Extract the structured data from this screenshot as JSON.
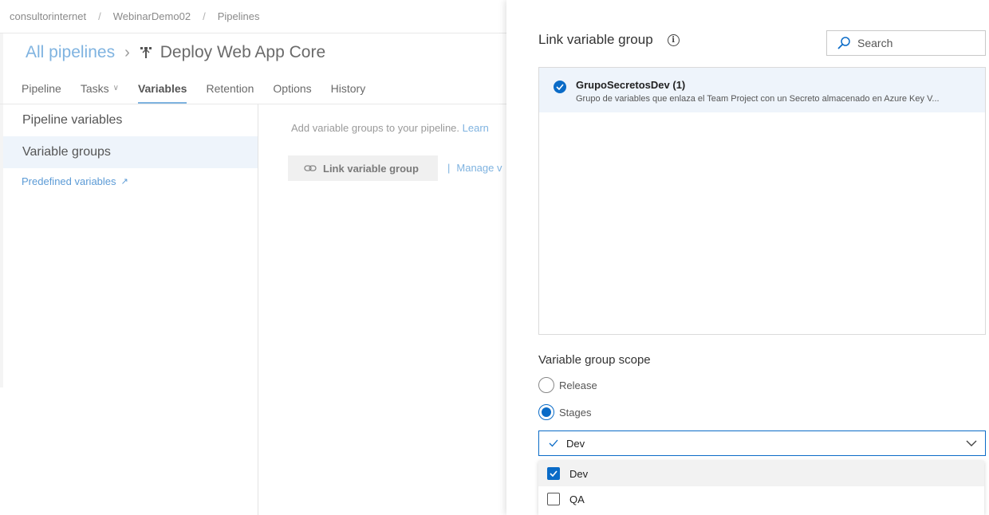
{
  "breadcrumb": {
    "org": "consultorinternet",
    "project": "WebinarDemo02",
    "section": "Pipelines"
  },
  "header": {
    "all_pipelines": "All pipelines",
    "pipeline_name": "Deploy Web App Core"
  },
  "tabs": [
    {
      "label": "Pipeline"
    },
    {
      "label": "Tasks"
    },
    {
      "label": "Variables"
    },
    {
      "label": "Retention"
    },
    {
      "label": "Options"
    },
    {
      "label": "History"
    }
  ],
  "sidebar": {
    "items": [
      {
        "label": "Pipeline variables"
      },
      {
        "label": "Variable groups"
      }
    ],
    "predefined_link": "Predefined variables"
  },
  "main": {
    "hint": "Add variable groups to your pipeline.",
    "learn": "Learn",
    "link_button": "Link variable group",
    "manage_link": "Manage v"
  },
  "panel": {
    "title": "Link variable group",
    "search_placeholder": "Search",
    "groups": [
      {
        "name": "GrupoSecretosDev (1)",
        "description": "Grupo de variables que enlaza el Team Project con un Secreto almacenado en Azure Key V..."
      }
    ],
    "scope_title": "Variable group scope",
    "scope_options": [
      {
        "label": "Release",
        "selected": false
      },
      {
        "label": "Stages",
        "selected": true
      }
    ],
    "stage_select_value": "Dev",
    "stage_options": [
      {
        "label": "Dev",
        "checked": true
      },
      {
        "label": "QA",
        "checked": false
      }
    ]
  },
  "colors": {
    "accent": "#0a6bc7",
    "link": "#7fb3e0",
    "selected_bg": "#eef4fb"
  }
}
